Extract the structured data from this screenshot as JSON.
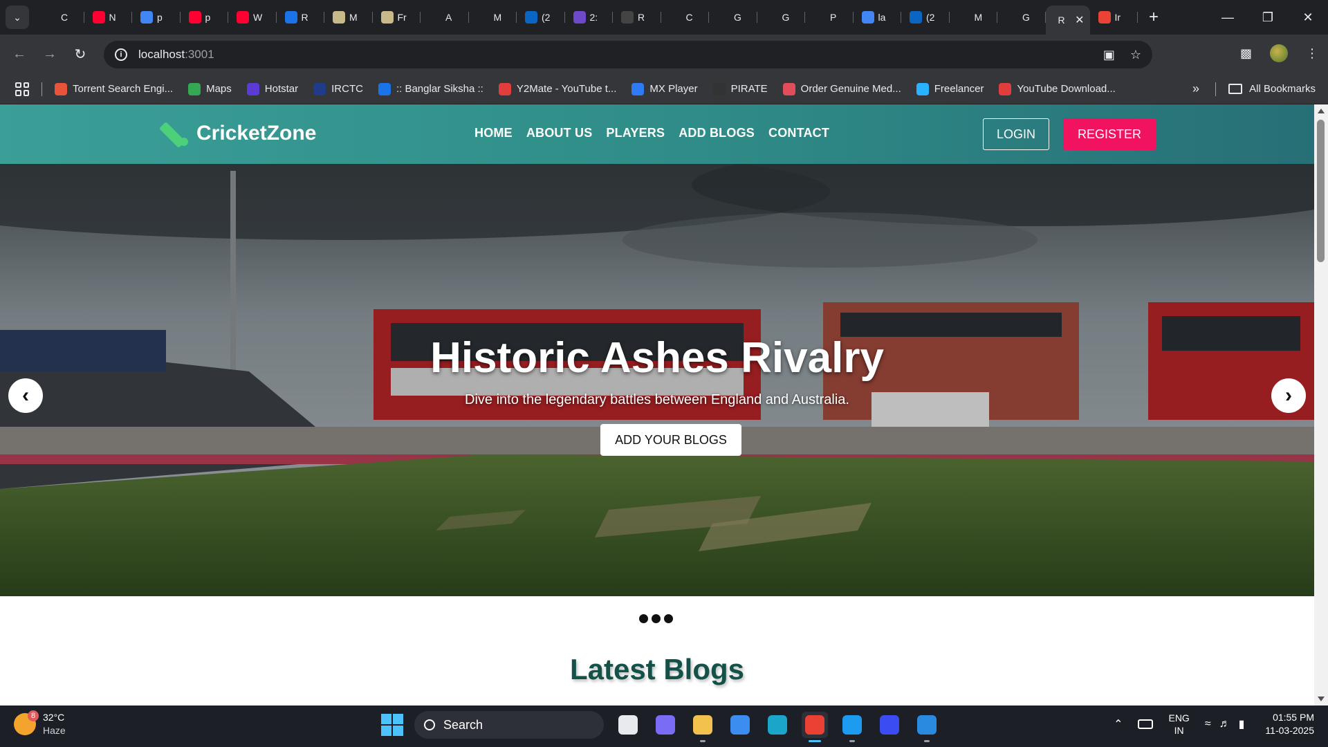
{
  "browser": {
    "tabs": [
      {
        "label": "C",
        "icon": "triangle-icon",
        "color": "#202124"
      },
      {
        "label": "N",
        "icon": "youtube-icon",
        "color": "#ff0033"
      },
      {
        "label": "p",
        "icon": "google-icon",
        "color": "#4285f4"
      },
      {
        "label": "p",
        "icon": "youtube-icon",
        "color": "#ff0033"
      },
      {
        "label": "W",
        "icon": "youtube-icon",
        "color": "#ff0033"
      },
      {
        "label": "R",
        "icon": "tool-icon",
        "color": "#1a73e8"
      },
      {
        "label": "M",
        "icon": "card-icon",
        "color": "#c8b98a"
      },
      {
        "label": "Fr",
        "icon": "card-icon",
        "color": "#c8b98a"
      },
      {
        "label": "A",
        "icon": "openai-icon",
        "color": "#202124"
      },
      {
        "label": "M",
        "icon": "openai-icon",
        "color": "#202124"
      },
      {
        "label": "(2",
        "icon": "linkedin-icon",
        "color": "#0a66c2"
      },
      {
        "label": "2:",
        "icon": "hash-icon",
        "color": "#6e49c9"
      },
      {
        "label": "R",
        "icon": "person-icon",
        "color": "#444"
      },
      {
        "label": "C",
        "icon": "triangle-icon",
        "color": "#202124"
      },
      {
        "label": "G",
        "icon": "github-icon",
        "color": "#202124"
      },
      {
        "label": "G",
        "icon": "github-icon",
        "color": "#202124"
      },
      {
        "label": "P",
        "icon": "github-icon",
        "color": "#202124"
      },
      {
        "label": "la",
        "icon": "google-icon",
        "color": "#4285f4"
      },
      {
        "label": "(2",
        "icon": "linkedin-icon",
        "color": "#0a66c2"
      },
      {
        "label": "M",
        "icon": "triangle-icon",
        "color": "#202124"
      },
      {
        "label": "G",
        "icon": "github-icon",
        "color": "#202124"
      },
      {
        "label": "R",
        "icon": "none",
        "color": "#35363a",
        "active": true
      },
      {
        "label": "Ir",
        "icon": "gmail-icon",
        "color": "#ea4335"
      }
    ],
    "url_host": "localhost",
    "url_port": ":3001",
    "bookmarks": [
      {
        "label": "Torrent Search Engi...",
        "icon": "x-icon",
        "color": "#e8533b"
      },
      {
        "label": "Maps",
        "icon": "maps-pin-icon",
        "color": "#34a853"
      },
      {
        "label": "Hotstar",
        "icon": "hotstar-icon",
        "color": "#5b3bd6"
      },
      {
        "label": "IRCTC",
        "icon": "irctc-icon",
        "color": "#1f3b8a"
      },
      {
        "label": ":: Banglar Siksha ::",
        "icon": "person-icon",
        "color": "#1a73e8"
      },
      {
        "label": "Y2Mate - YouTube t...",
        "icon": "y2mate-icon",
        "color": "#e23d3d"
      },
      {
        "label": "MX Player",
        "icon": "play-icon",
        "color": "#2f7bf5"
      },
      {
        "label": "PIRATE",
        "icon": "shield-icon",
        "color": "#333"
      },
      {
        "label": "Order Genuine Med...",
        "icon": "pharmacy-icon",
        "color": "#e14d5a"
      },
      {
        "label": "Freelancer",
        "icon": "freelancer-icon",
        "color": "#29b2fe"
      },
      {
        "label": "YouTube Download...",
        "icon": "download-icon",
        "color": "#e23d3d"
      }
    ],
    "all_bookmarks": "All Bookmarks"
  },
  "site": {
    "logo": "CricketZone",
    "nav": [
      "HOME",
      "ABOUT US",
      "PLAYERS",
      "ADD BLOGS",
      "CONTACT"
    ],
    "login": "LOGIN",
    "register": "REGISTER",
    "hero": {
      "title": "Historic Ashes Rivalry",
      "subtitle": "Dive into the legendary battles between England and Australia.",
      "cta": "ADD YOUR BLOGS",
      "slide_count": 3
    },
    "section_title": "Latest Blogs"
  },
  "taskbar": {
    "temperature": "32°C",
    "condition": "Haze",
    "weather_badge": "8",
    "search": "Search",
    "apps": [
      {
        "name": "task-view",
        "icon": "task-view-icon",
        "color": "#e8eaed"
      },
      {
        "name": "copilot",
        "icon": "copilot-icon",
        "color": "#7b6cf6"
      },
      {
        "name": "file-explorer",
        "icon": "folder-icon",
        "color": "#f2c14e"
      },
      {
        "name": "mail",
        "icon": "mail-icon",
        "color": "#3b8df0"
      },
      {
        "name": "edge",
        "icon": "edge-icon",
        "color": "#1aa5c9"
      },
      {
        "name": "chrome",
        "icon": "chrome-icon",
        "color": "#e94235"
      },
      {
        "name": "skype",
        "icon": "skype-icon",
        "color": "#1c9bf0"
      },
      {
        "name": "app-m",
        "icon": "m-app-icon",
        "color": "#3a4cf2"
      },
      {
        "name": "vscode",
        "icon": "vscode-icon",
        "color": "#2a8ae0"
      }
    ],
    "lang_1": "ENG",
    "lang_2": "IN",
    "time": "01:55 PM",
    "date": "11-03-2025"
  }
}
